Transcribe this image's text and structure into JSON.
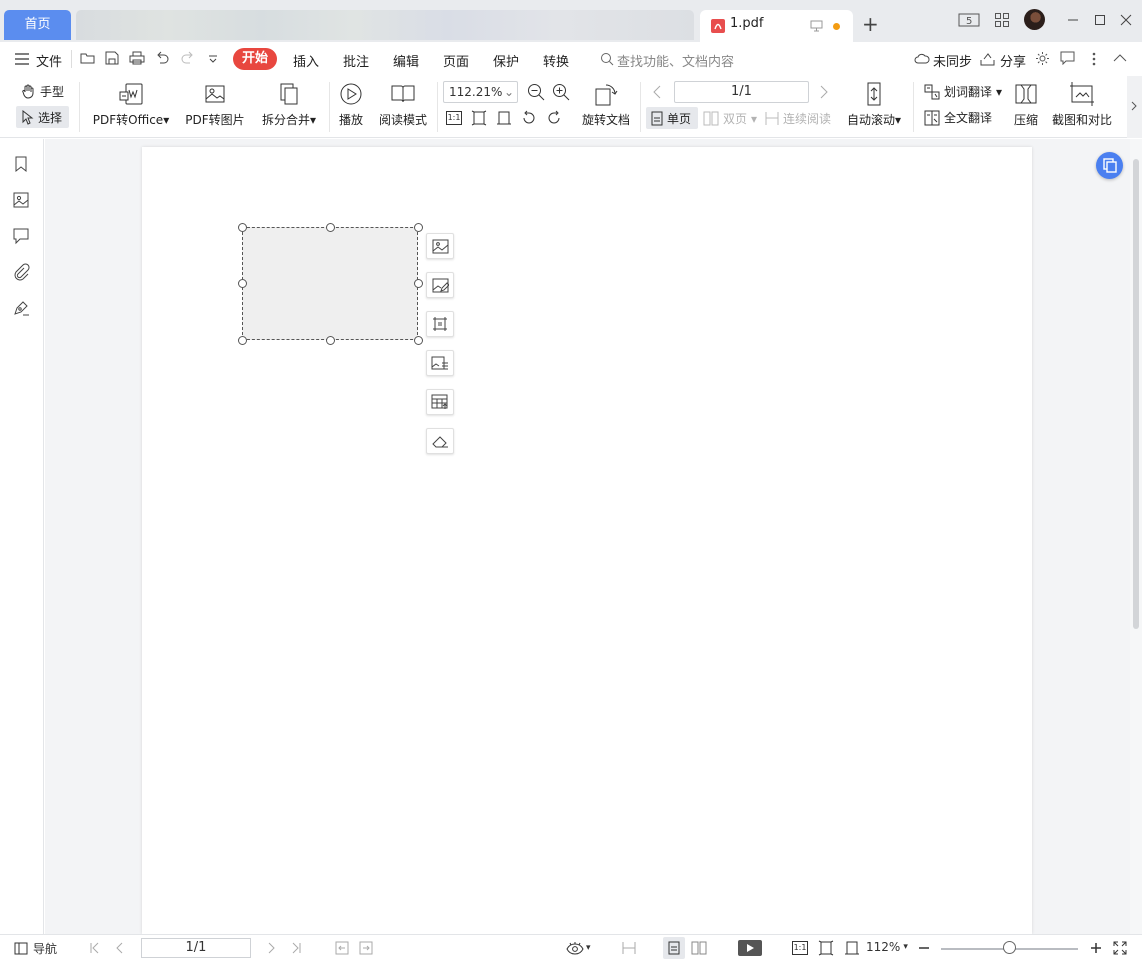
{
  "titlebar": {
    "home_tab": "首页",
    "file_tab": "1.pdf",
    "new_tab": "+",
    "badge_5": "5"
  },
  "menubar": {
    "file_menu": "文件",
    "tabs": [
      "开始",
      "插入",
      "批注",
      "编辑",
      "页面",
      "保护",
      "转换"
    ],
    "search_placeholder": "查找功能、文档内容",
    "sync_status": "未同步",
    "share": "分享"
  },
  "toolbar": {
    "hand_tool": "手型",
    "select_tool": "选择",
    "pdf_to_office": "PDF转Office",
    "pdf_to_image": "PDF转图片",
    "split_merge": "拆分合并",
    "play": "播放",
    "read_mode": "阅读模式",
    "zoom_value": "112.21%",
    "actual_size": "1:1",
    "rotate_doc": "旋转文档",
    "page_value": "1/1",
    "single_page": "单页",
    "double_page": "双页",
    "continuous_read": "连续阅读",
    "auto_scroll": "自动滚动",
    "word_translate": "划词翻译",
    "full_translate": "全文翻译",
    "compress": "压缩",
    "screenshot_compare": "截图和对比"
  },
  "statusbar": {
    "nav": "导航",
    "page_value": "1/1",
    "actual_size": "1:1",
    "zoom": "112%",
    "zoom_fraction": 0.5
  },
  "icons": {
    "accent_red": "#e8473f",
    "accent_blue": "#5b8def",
    "float_button_blue": "#4a7ff0"
  }
}
